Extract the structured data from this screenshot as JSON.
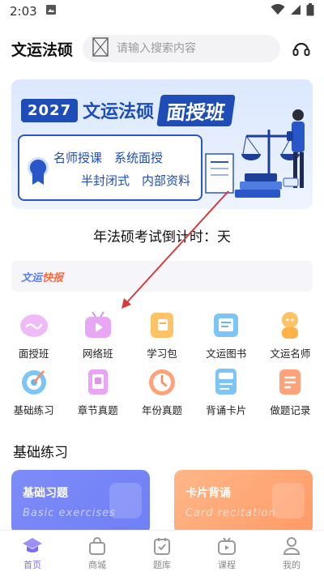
{
  "status_bar": {
    "time": "2:03"
  },
  "header": {
    "title": "文运法硕",
    "search_placeholder": "请输入搜索内容",
    "support_icon": "headset-icon"
  },
  "banner": {
    "year": "2027",
    "brand": "文运法硕",
    "class_name": "面授班",
    "line1": "名师授课　系统面授",
    "line2": "半封闭式　内部资料"
  },
  "countdown": {
    "text": "年法硕考试倒计时：天"
  },
  "news": {
    "tag_part1": "文运",
    "tag_part2": "快报"
  },
  "grid": [
    {
      "label": "面授班",
      "icon": "face-class-icon",
      "color": "#e9a6f5"
    },
    {
      "label": "网络班",
      "icon": "online-class-icon",
      "color": "#d98cf2"
    },
    {
      "label": "学习包",
      "icon": "study-pack-icon",
      "color": "#ffb347"
    },
    {
      "label": "文运图书",
      "icon": "book-icon",
      "color": "#5fb9f5"
    },
    {
      "label": "文运名师",
      "icon": "teacher-icon",
      "color": "#ffb347"
    },
    {
      "label": "基础练习",
      "icon": "target-icon",
      "color": "#5fb9f5"
    },
    {
      "label": "章节真题",
      "icon": "chapter-icon",
      "color": "#e38ff3"
    },
    {
      "label": "年份真题",
      "icon": "clock-icon",
      "color": "#ff8a5c"
    },
    {
      "label": "背诵卡片",
      "icon": "card-icon",
      "color": "#5fb9f5"
    },
    {
      "label": "做题记录",
      "icon": "record-icon",
      "color": "#ff8a5c"
    }
  ],
  "section": {
    "title": "基础练习"
  },
  "cards": [
    {
      "title": "基础习题",
      "subtitle": "Basic exercises"
    },
    {
      "title": "卡片背诵",
      "subtitle": "Card recitation"
    }
  ],
  "bottom_nav": [
    {
      "label": "首页",
      "icon": "home-icon",
      "active": true
    },
    {
      "label": "商城",
      "icon": "shop-icon",
      "active": false
    },
    {
      "label": "题库",
      "icon": "question-bank-icon",
      "active": false
    },
    {
      "label": "课程",
      "icon": "course-icon",
      "active": false
    },
    {
      "label": "我的",
      "icon": "profile-icon",
      "active": false
    }
  ],
  "colors": {
    "accent": "#7b6ef6",
    "brand_blue": "#1e4db7",
    "arrow": "#d63a3a"
  }
}
